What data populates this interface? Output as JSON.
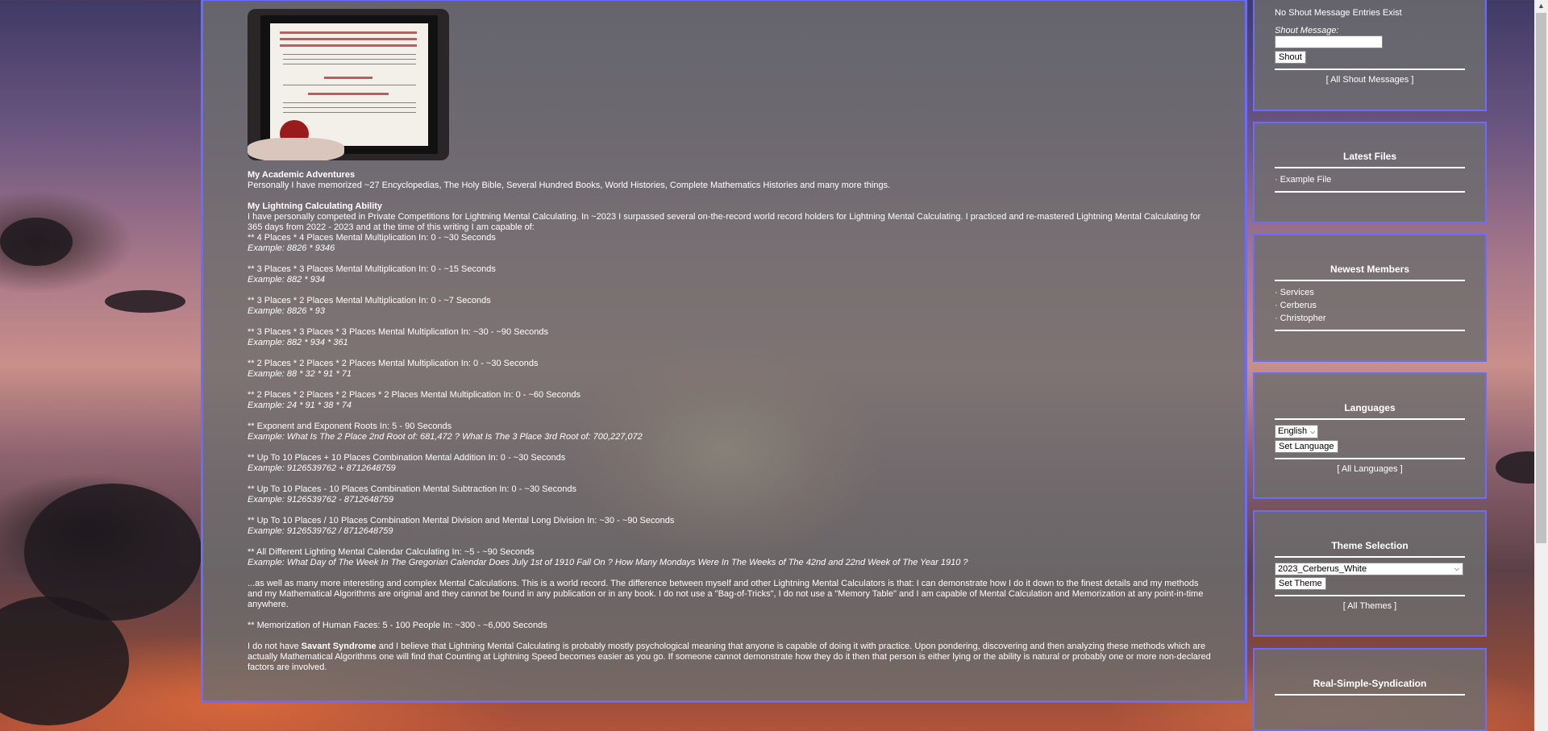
{
  "main": {
    "image_alt": "Doctorem Honoris Causa diploma",
    "diploma_text": [
      "Rector et Collegium Decanorum",
      "Universitatis Traiecti ad Mosam",
      "Lectoribus Salutem",
      "Jimmy Veldas",
      "Doctorem Honoris Causa"
    ],
    "sections": [
      {
        "type": "heading",
        "text": "My Academic Adventures"
      },
      {
        "type": "text",
        "text": "Personally I have memorized ~27 Encyclopedias, The Holy Bible, Several Hundred Books, World Histories, Complete Mathematics Histories and many more things."
      },
      {
        "type": "gap"
      },
      {
        "type": "heading",
        "text": "My Lightning Calculating Ability"
      },
      {
        "type": "text",
        "text": "I have personally competed in Private Competitions for Lightning Mental Calculating. In ~2023 I surpassed several on-the-record world record holders for Lightning Mental Calculating. I practiced and re-mastered Lightning Mental Calculating for 365 days from 2022 - 2023 and at the time of this writing I am capable of:"
      },
      {
        "type": "text",
        "text": "** 4 Places * 4 Places Mental Multiplication In: 0 - ~30 Seconds"
      },
      {
        "type": "ex",
        "text": "Example: 8826 * 9346"
      },
      {
        "type": "gap"
      },
      {
        "type": "text",
        "text": "** 3 Places * 3 Places Mental Multiplication In: 0 - ~15 Seconds"
      },
      {
        "type": "ex",
        "text": "Example: 882 * 934"
      },
      {
        "type": "gap"
      },
      {
        "type": "text",
        "text": "** 3 Places * 2 Places Mental Multiplication In: 0 - ~7 Seconds"
      },
      {
        "type": "ex",
        "text": "Example: 8826 * 93"
      },
      {
        "type": "gap"
      },
      {
        "type": "text",
        "text": "** 3 Places * 3 Places * 3 Places Mental Multiplication In: ~30 - ~90 Seconds"
      },
      {
        "type": "ex",
        "text": "Example: 882 * 934 * 361"
      },
      {
        "type": "gap"
      },
      {
        "type": "text",
        "text": "** 2 Places * 2 Places * 2 Places Mental Multiplication In: 0 - ~30 Seconds"
      },
      {
        "type": "ex",
        "text": "Example: 88 * 32 * 91 * 71"
      },
      {
        "type": "gap"
      },
      {
        "type": "text",
        "text": "** 2 Places * 2 Places * 2 Places * 2 Places Mental Multiplication In: 0 - ~60 Seconds"
      },
      {
        "type": "ex",
        "text": "Example: 24 * 91 * 38 * 74"
      },
      {
        "type": "gap"
      },
      {
        "type": "text",
        "text": "** Exponent and Exponent Roots In: 5 - 90 Seconds"
      },
      {
        "type": "ex",
        "text": "Example: What Is The 2 Place 2nd Root of: 681,472 ? What Is The 3 Place 3rd Root of: 700,227,072"
      },
      {
        "type": "gap"
      },
      {
        "type": "text",
        "text": "** Up To 10 Places + 10 Places Combination Mental Addition In: 0 - ~30 Seconds"
      },
      {
        "type": "ex",
        "text": "Example: 9126539762 + 8712648759"
      },
      {
        "type": "gap"
      },
      {
        "type": "text",
        "text": "** Up To 10 Places - 10 Places Combination Mental Subtraction In: 0 - ~30 Seconds"
      },
      {
        "type": "ex",
        "text": "Example: 9126539762 - 8712648759"
      },
      {
        "type": "gap"
      },
      {
        "type": "text",
        "text": "** Up To 10 Places / 10 Places Combination Mental Division and Mental Long Division In: ~30 - ~90 Seconds"
      },
      {
        "type": "ex",
        "text": "Example: 9126539762 / 8712648759"
      },
      {
        "type": "gap"
      },
      {
        "type": "text",
        "text": "** All Different Lighting Mental Calendar Calculating In: ~5 - ~90 Seconds"
      },
      {
        "type": "ex",
        "text": "Example: What Day of The Week In The Gregorian Calendar Does July 1st of 1910 Fall On ? How Many Mondays Were In The Weeks of The 42nd and 22nd Week of The Year 1910 ?"
      },
      {
        "type": "gap"
      },
      {
        "type": "text",
        "text": "...as well as many more interesting and complex Mental Calculations. This is a world record. The difference between myself and other Lightning Mental Calculators is that: I can demonstrate how I do it down to the finest details and my methods and my Mathematical Algorithms are original and they cannot be found in any publication or in any book. I do not use a \"Bag-of-Tricks\", I do not use a \"Memory Table\" and I am capable of Mental Calculation and Memorization at any point-in-time anywhere."
      },
      {
        "type": "gap"
      },
      {
        "type": "text",
        "text": "** Memorization of Human Faces: 5 - 100 People In: ~300 - ~6,000 Seconds"
      },
      {
        "type": "gap"
      }
    ],
    "last_para": {
      "pre": "I do not have ",
      "bold": "Savant Syndrome",
      "post": " and I believe that Lightning Mental Calculating is probably mostly psychological meaning that anyone is capable of doing it with practice. Upon pondering, discovering and then analyzing these methods which are actually Mathematical Algorithms one will find that Counting at Lightning Speed becomes easier as you go. If someone cannot demonstrate how they do it then that person is either lying or the ability is natural or probably one or more non-declared factors are involved."
    }
  },
  "shout": {
    "no_entries": "No Shout Message Entries Exist",
    "label": "Shout Message:",
    "input_value": "",
    "button": "Shout",
    "all_link": "[ All Shout Messages ]"
  },
  "latest_files": {
    "title": "Latest Files",
    "items": [
      "Example File"
    ]
  },
  "newest_members": {
    "title": "Newest Members",
    "items": [
      "Services",
      "Cerberus",
      "Christopher"
    ]
  },
  "languages": {
    "title": "Languages",
    "selected": "English",
    "button": "Set Language",
    "all_link": "[ All Languages ]"
  },
  "theme": {
    "title": "Theme Selection",
    "selected": "2023_Cerberus_White",
    "button": "Set Theme",
    "all_link": "[ All Themes ]"
  },
  "rss": {
    "title": "Real-Simple-Syndication"
  },
  "icons": [
    "chevron-down-icon",
    "scroll-up-arrow-icon"
  ]
}
